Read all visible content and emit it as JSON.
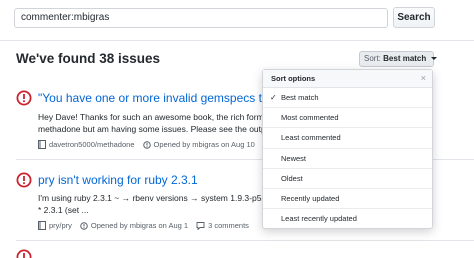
{
  "search": {
    "query": "commenter:mbigras",
    "button_label": "Search"
  },
  "results": {
    "title": "We've found 38 issues",
    "sort_prefix": "Sort:",
    "sort_value": "Best match"
  },
  "sort_menu": {
    "header": "Sort options",
    "close_glyph": "×",
    "items": [
      {
        "label": "Best match",
        "selected": true
      },
      {
        "label": "Most commented",
        "selected": false
      },
      {
        "label": "Least commented",
        "selected": false
      },
      {
        "label": "Newest",
        "selected": false
      },
      {
        "label": "Oldest",
        "selected": false
      },
      {
        "label": "Recently updated",
        "selected": false
      },
      {
        "label": "Least recently updated",
        "selected": false
      }
    ]
  },
  "issues": [
    {
      "title": "\"You have one or more invalid gemspecs that r",
      "body_line1": "Hey Dave! Thanks for such an awesome book, the rich form",
      "body_line2": "methadone but am having some issues. Please see the outp",
      "repo": "davetron5000/methadone",
      "opened": "Opened by mbigras on Aug 10",
      "comments": "",
      "status_color": "#cb2431"
    },
    {
      "title": "pry isn't working for ruby 2.3.1",
      "body_line1": "I'm using ruby 2.3.1 ~ → rbenv versions → system 1.9.3-p55",
      "body_line2": "* 2.3.1 (set ...",
      "repo": "pry/pry",
      "opened": "Opened by mbigras on Aug 1",
      "comments": "3 comments",
      "status_color": "#cb2431"
    }
  ]
}
